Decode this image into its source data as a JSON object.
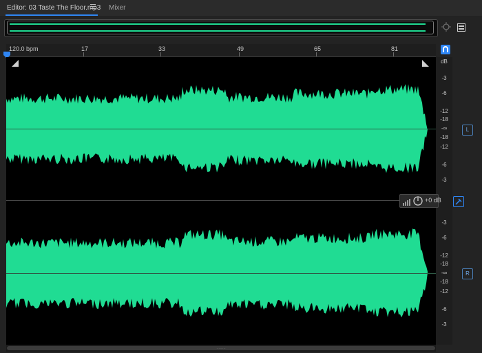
{
  "tabs": {
    "editor_label": "Editor: 03 Taste The Floor.mp3",
    "mixer_label": "Mixer"
  },
  "ruler": {
    "labels": [
      "120.0 bpm",
      "17",
      "33",
      "49",
      "65",
      "81"
    ]
  },
  "db_scale": {
    "unit_label": "dB",
    "left_channel_labels": [
      "-3",
      "-6",
      "-12",
      "-18",
      "-∞",
      "-18",
      "-12",
      "-6",
      "-3"
    ],
    "right_channel_labels": [
      "-3",
      "-6",
      "-12",
      "-18",
      "-∞",
      "-18",
      "-12",
      "-6",
      "-3"
    ]
  },
  "channels": {
    "left_label": "L",
    "right_label": "R"
  },
  "hud": {
    "volume_text": "+0 dB"
  },
  "scrollbar": {
    "grip": "........"
  },
  "colors": {
    "waveform": "#20dc93",
    "accent": "#2f86f5",
    "background": "#000000"
  },
  "icons": {
    "tab_menu": "hamburger-menu-icon",
    "zoom": "zoom-icon",
    "time_selection": "time-selection-icon",
    "snap": "snap-magnet-icon",
    "marker": "marker-pin-icon",
    "playhead": "playhead-icon",
    "volume_bars": "volume-bars-icon",
    "volume_knob": "volume-knob-icon",
    "pin": "pin-icon"
  }
}
